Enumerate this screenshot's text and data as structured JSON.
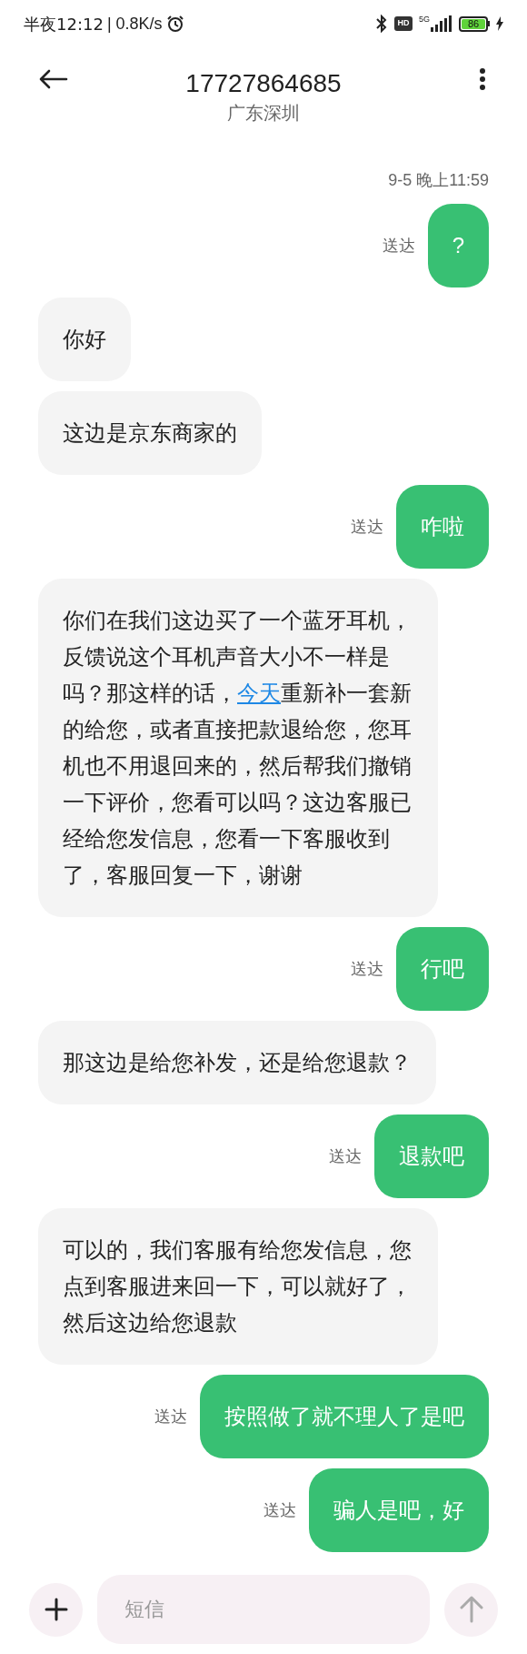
{
  "status_bar": {
    "time": "半夜12:12",
    "speed": "| 0.8K/s",
    "hd": "HD",
    "network": "5G",
    "battery": "86"
  },
  "header": {
    "title": "17727864685",
    "subtitle": "广东深圳"
  },
  "timestamp": "9-5 晚上11:59",
  "messages": [
    {
      "kind": "sent",
      "status": "送达",
      "parts": [
        {
          "text": "?",
          "link": false
        }
      ]
    },
    {
      "kind": "received",
      "parts": [
        {
          "text": "你好",
          "link": false
        }
      ]
    },
    {
      "kind": "received",
      "parts": [
        {
          "text": "这边是京东商家的",
          "link": false
        }
      ]
    },
    {
      "kind": "sent",
      "status": "送达",
      "parts": [
        {
          "text": "咋啦",
          "link": false
        }
      ]
    },
    {
      "kind": "received",
      "parts": [
        {
          "text": "你们在我们这边买了一个蓝牙耳机，反馈说这个耳机声音大小不一样是吗？那这样的话，",
          "link": false
        },
        {
          "text": "今天",
          "link": true
        },
        {
          "text": "重新补一套新的给您，或者直接把款退给您，您耳机也不用退回来的，然后帮我们撤销一下评价，您看可以吗？这边客服已经给您发信息，您看一下客服收到了，客服回复一下，谢谢",
          "link": false
        }
      ]
    },
    {
      "kind": "sent",
      "status": "送达",
      "parts": [
        {
          "text": "行吧",
          "link": false
        }
      ]
    },
    {
      "kind": "received",
      "parts": [
        {
          "text": "那这边是给您补发，还是给您退款？",
          "link": false
        }
      ]
    },
    {
      "kind": "sent",
      "status": "送达",
      "parts": [
        {
          "text": "退款吧",
          "link": false
        }
      ]
    },
    {
      "kind": "received",
      "parts": [
        {
          "text": "可以的，我们客服有给您发信息，您点到客服进来回一下，可以就好了，然后这边给您退款",
          "link": false
        }
      ]
    },
    {
      "kind": "sent",
      "status": "送达",
      "parts": [
        {
          "text": "按照做了就不理人了是吧",
          "link": false
        }
      ]
    },
    {
      "kind": "sent",
      "status": "送达",
      "parts": [
        {
          "text": "骗人是吧，好",
          "link": false
        }
      ]
    }
  ],
  "composer": {
    "placeholder": "短信"
  }
}
